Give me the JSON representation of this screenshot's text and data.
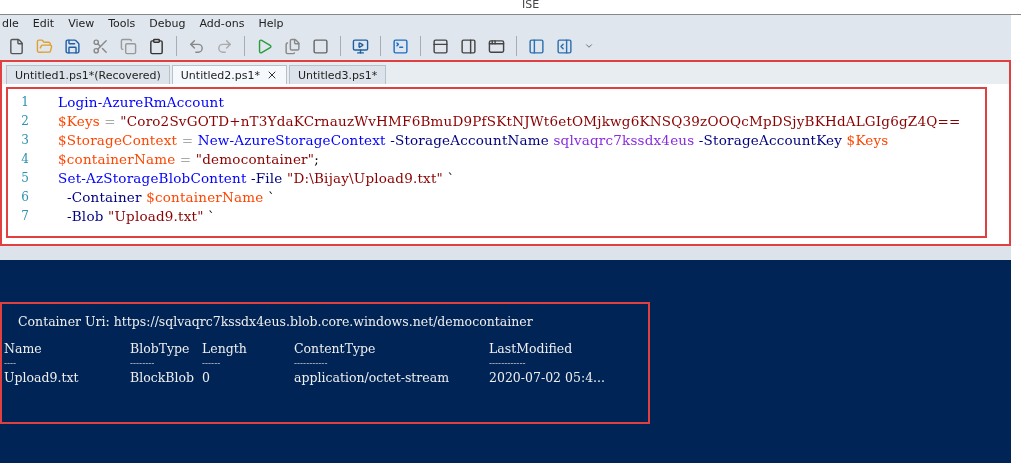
{
  "window": {
    "title": "ISE"
  },
  "menu": [
    "dle",
    "Edit",
    "View",
    "Tools",
    "Debug",
    "Add-ons",
    "Help"
  ],
  "tabs": [
    {
      "label": "Untitled1.ps1*(Recovered)",
      "selected": false
    },
    {
      "label": "Untitled2.ps1*",
      "selected": true
    },
    {
      "label": "Untitled3.ps1*",
      "selected": false
    }
  ],
  "editor": {
    "lines": [
      {
        "number": "1",
        "tokens": [
          {
            "kind": "cmdlet",
            "text": "Login-AzureRmAccount"
          }
        ]
      },
      {
        "number": "2",
        "tokens": [
          {
            "kind": "variable",
            "text": "$Keys"
          },
          {
            "kind": "operator",
            "text": " = "
          },
          {
            "kind": "string",
            "text": "\"Coro2SvGOTD+nT3YdaKCrnauzWvHMF6BmuD9PfSKtNJWt6etOMjkwg6KNSQ39zOOQcMpDSjyBKHdALGIg6gZ4Q=="
          }
        ]
      },
      {
        "number": "3",
        "tokens": [
          {
            "kind": "variable",
            "text": "$StorageContext"
          },
          {
            "kind": "operator",
            "text": " = "
          },
          {
            "kind": "cmdlet",
            "text": "New-AzureStorageContext"
          },
          {
            "kind": "param",
            "text": " -StorageAccountName "
          },
          {
            "kind": "argument",
            "text": "sqlvaqrc7kssdx4eus"
          },
          {
            "kind": "param",
            "text": " -StorageAccountKey "
          },
          {
            "kind": "variable",
            "text": "$Keys"
          }
        ]
      },
      {
        "number": "4",
        "tokens": [
          {
            "kind": "variable",
            "text": "$containerName"
          },
          {
            "kind": "operator",
            "text": " = "
          },
          {
            "kind": "string",
            "text": "\"democontainer\""
          },
          {
            "kind": "plain",
            "text": ";"
          }
        ]
      },
      {
        "number": "5",
        "tokens": [
          {
            "kind": "cmdlet",
            "text": "Set-AzStorageBlobContent"
          },
          {
            "kind": "param",
            "text": " -File "
          },
          {
            "kind": "string",
            "text": "\"D:\\Bijay\\Upload9.txt\""
          },
          {
            "kind": "plain",
            "text": " `"
          }
        ]
      },
      {
        "number": "6",
        "tokens": [
          {
            "kind": "param",
            "text": "  -Container "
          },
          {
            "kind": "variable",
            "text": "$containerName"
          },
          {
            "kind": "plain",
            "text": " `"
          }
        ]
      },
      {
        "number": "7",
        "tokens": [
          {
            "kind": "param",
            "text": "  -Blob "
          },
          {
            "kind": "string",
            "text": "\"Upload9.txt\""
          },
          {
            "kind": "plain",
            "text": " `"
          }
        ]
      }
    ]
  },
  "console": {
    "uri_line": "Container Uri: https://sqlvaqrc7kssdx4eus.blob.core.windows.net/democontainer",
    "columns": [
      "Name",
      "BlobType",
      "Length",
      "ContentType",
      "LastModified"
    ],
    "underlines": [
      "----",
      "--------",
      "------",
      "-----------",
      "------------"
    ],
    "rows": [
      [
        "Upload9.txt",
        "BlockBlob",
        "0",
        "application/octet-stream",
        "2020-07-02 05:4..."
      ]
    ]
  }
}
